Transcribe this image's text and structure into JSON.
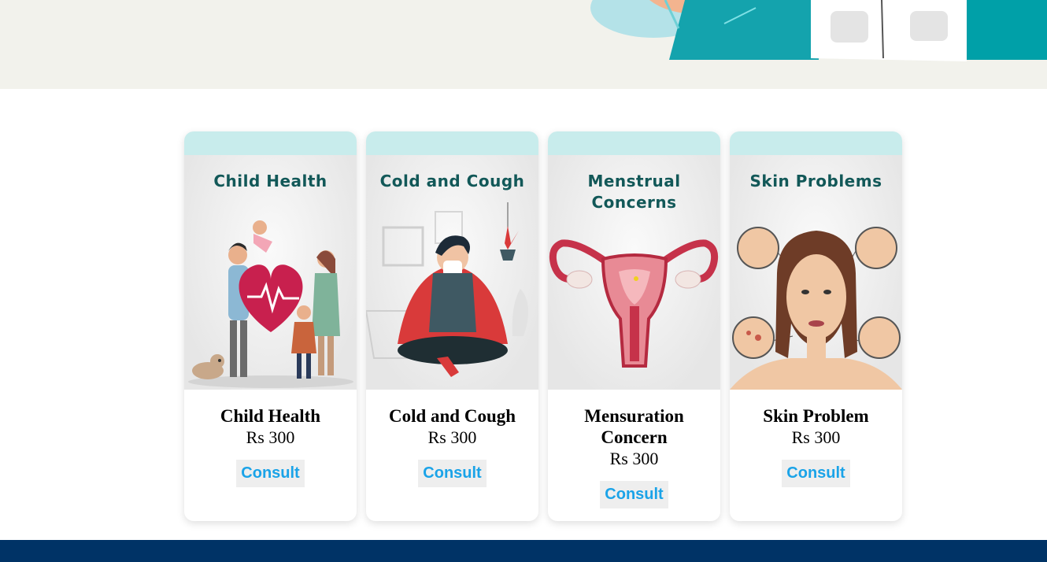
{
  "cards": [
    {
      "image_title": "Child Health",
      "name": "Child Health",
      "price": "Rs 300",
      "button": "Consult"
    },
    {
      "image_title": "Cold and Cough",
      "name": "Cold and Cough",
      "price": "Rs 300",
      "button": "Consult"
    },
    {
      "image_title_line1": "Menstrual",
      "image_title_line2": "Concerns",
      "name": "Mensuration Concern",
      "price": "Rs 300",
      "button": "Consult"
    },
    {
      "image_title": "Skin Problems",
      "name": "Skin Problem",
      "price": "Rs 300",
      "button": "Consult"
    }
  ],
  "footer": {
    "text": ""
  },
  "colors": {
    "accent": "#1aa3e8",
    "band": "#c8ecec",
    "footer": "#003366",
    "hero_bg": "#f2f2ec",
    "title_teal": "#125858"
  }
}
